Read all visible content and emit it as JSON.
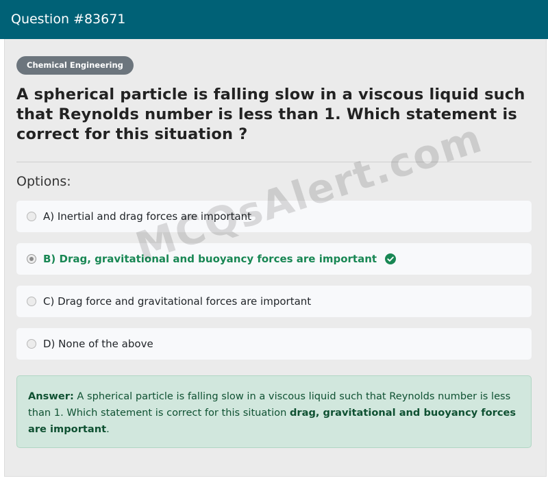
{
  "header": {
    "title": "Question #83671"
  },
  "category": "Chemical Engineering",
  "question": "A spherical particle is falling slow in a viscous liquid such that Reynolds number is less than 1. Which statement is correct for this situation ?",
  "options_label": "Options:",
  "options": [
    {
      "text": "A) Inertial and drag forces are important",
      "selected": false,
      "correct": false
    },
    {
      "text": "B) Drag, gravitational and buoyancy forces are important",
      "selected": true,
      "correct": true
    },
    {
      "text": "C) Drag force and gravitational forces are important",
      "selected": false,
      "correct": false
    },
    {
      "text": "D) None of the above",
      "selected": false,
      "correct": false
    }
  ],
  "answer": {
    "label": "Answer:",
    "text": " A spherical particle is falling slow in a viscous liquid such that Reynolds number is less than 1. Which statement is correct for this situation ",
    "bold_text": "drag, gravitational and buoyancy forces are important",
    "suffix": "."
  },
  "watermark": "MCQsAlert.com",
  "colors": {
    "header_bg": "#006176",
    "correct": "#198754",
    "answer_bg": "#d1e7dd",
    "chip_bg": "#6c757d"
  },
  "icons": {
    "correct": "check-circle-icon"
  }
}
